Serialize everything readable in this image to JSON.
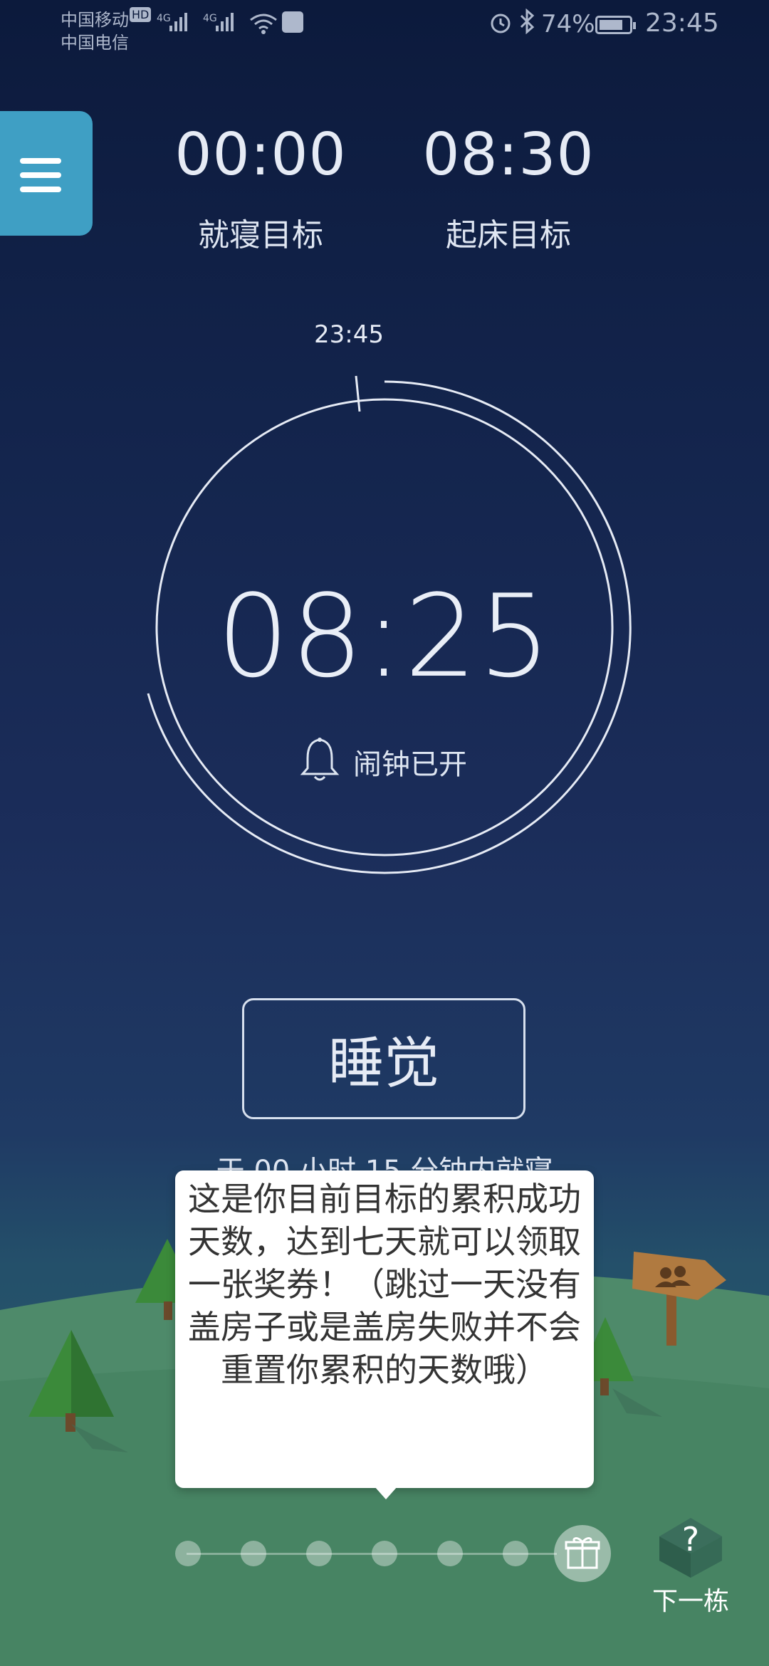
{
  "status_bar": {
    "carrier_1": "中国移动",
    "carrier_2": "中国电信",
    "hd_badge": "HD",
    "network_1": "4G",
    "network_2": "4G",
    "battery_percent": "74%",
    "battery_level": 0.74,
    "time": "23:45"
  },
  "targets": {
    "bedtime_value": "00:00",
    "bedtime_label": "就寝目标",
    "wake_value": "08:30",
    "wake_label": "起床目标"
  },
  "dial": {
    "current_time": "23:45",
    "alarm_time": "08:25",
    "alarm_status": "闹钟已开"
  },
  "sleep_button": {
    "label": "睡觉"
  },
  "subtitle": "于 00 小时 15 分钟内就寝",
  "tooltip": {
    "text": "这是你目前目标的累积成功天数，达到七天就可以领取一张奖券！（跳过一天没有盖房子或是盖房失败并不会重置你累积的天数哦）"
  },
  "progress": {
    "days_total": 7,
    "days_completed": 0
  },
  "next_building": {
    "label": "下一栋",
    "icon": "question-mark"
  },
  "colors": {
    "menu_button": "#3f9fc4",
    "ground": "#4e8a6a",
    "tree": "#3b8a3a"
  }
}
